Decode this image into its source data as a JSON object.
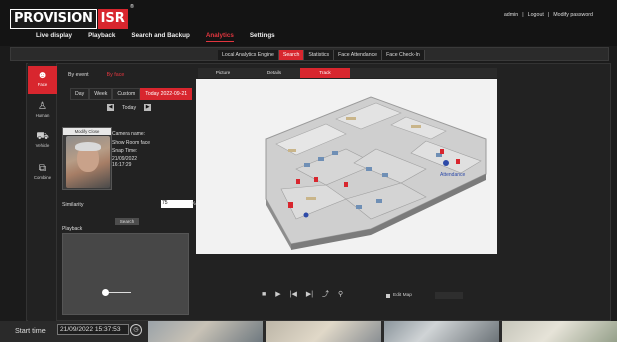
{
  "header": {
    "logo_text": "PROVISION",
    "logo_badge": "ISR",
    "logo_reg": "®",
    "nav": [
      {
        "label": "Live display",
        "active": false
      },
      {
        "label": "Playback",
        "active": false
      },
      {
        "label": "Search and Backup",
        "active": false
      },
      {
        "label": "Analytics",
        "active": true
      },
      {
        "label": "Settings",
        "active": false
      }
    ],
    "user": "admin",
    "sep1": "|",
    "logout": "Logout",
    "sep2": "|",
    "modify": "Modify password"
  },
  "subtabs": [
    {
      "label": "Local Analytics Engine",
      "active": false
    },
    {
      "label": "Search",
      "active": true
    },
    {
      "label": "Statistics",
      "active": false
    },
    {
      "label": "Face Attendance",
      "active": false
    },
    {
      "label": "Face Check-In",
      "active": false
    }
  ],
  "sidebar": [
    {
      "label": "Face",
      "icon": "face-icon",
      "glyph": "☻",
      "active": true
    },
    {
      "label": "Human",
      "icon": "human-icon",
      "glyph": "♙",
      "active": false
    },
    {
      "label": "Vehicle",
      "icon": "vehicle-icon",
      "glyph": "⛟",
      "active": false
    },
    {
      "label": "Combine",
      "icon": "combine-icon",
      "glyph": "⧉",
      "active": false
    }
  ],
  "left": {
    "by_event": "By event",
    "by_face": "By face",
    "tabs": [
      {
        "label": "Day",
        "active": false
      },
      {
        "label": "Week",
        "active": false
      },
      {
        "label": "Custom",
        "active": false
      },
      {
        "label": "Today 2022-09-21",
        "active": true
      }
    ],
    "day_prev": "◀",
    "day_label": "Today",
    "day_next": "▶",
    "card_caption": "Modify Close",
    "camera_name_label": "Camera name:",
    "camera_name": "Show Room face",
    "snap_time_label": "Snap Time:",
    "snap_date": "21/09/2022",
    "snap_time": "16:17:29",
    "similarity_label": "Similarity",
    "similarity_value": "75",
    "similarity_unit": "%",
    "search_button": "Search",
    "playback_label": "Playback"
  },
  "right": {
    "tabs": [
      {
        "label": "Picture",
        "active": false
      },
      {
        "label": "Details",
        "active": false
      },
      {
        "label": "Track",
        "active": true
      }
    ],
    "map_label": "Attendance",
    "edit_map": "Edit Map",
    "controls": [
      "stop-icon",
      "play-icon",
      "prev-icon",
      "next-icon",
      "route-icon",
      "zoom-icon"
    ]
  },
  "bottom": {
    "start_time_label": "Start time",
    "start_time_value": "21/09/2022 15:37:53"
  },
  "colors": {
    "accent": "#d8262e",
    "background": "#1b1b1b"
  }
}
